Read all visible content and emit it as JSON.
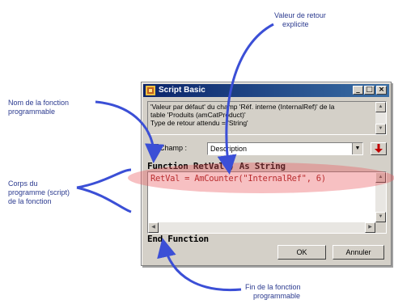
{
  "annotations": {
    "return_value": [
      "Valeur de retour",
      "explicite"
    ],
    "function_name": [
      "Nom de la fonction",
      "programmable"
    ],
    "body": [
      "Corps du",
      "programme (script)",
      "de la fonction"
    ],
    "end": [
      "Fin de la fonction",
      "programmable"
    ]
  },
  "window": {
    "title": "Script Basic",
    "controls": [
      "_",
      "□",
      "×"
    ],
    "description_lines": [
      "'Valeur par défaut' du champ 'Réf. interne (InternalRef)' de la",
      "table 'Produits (amCatProduct)'",
      "Type de retour attendu = 'String'"
    ],
    "field_label": "Champ :",
    "field_value": "Description",
    "insert_icon": "red-down-arrow-icon",
    "function_header": "Function RetVal() As String",
    "body_line": "RetVal = AmCounter(\"InternalRef\", 6)",
    "function_end": "End Function",
    "ok_label": "OK",
    "cancel_label": "Annuler"
  },
  "colors": {
    "annotation_text": "#2b3a8f",
    "arrow": "#3b4fd6",
    "highlight": "#eb5a5f",
    "code_body": "#9b1010",
    "titlebar": "#0a246a"
  }
}
